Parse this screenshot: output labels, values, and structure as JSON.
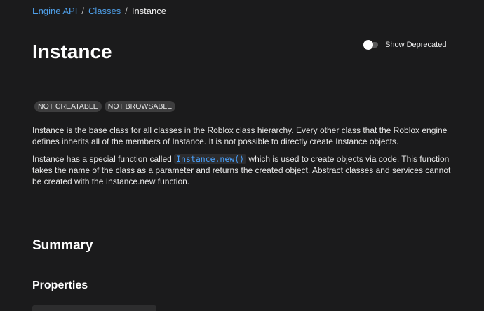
{
  "breadcrumb": {
    "items": [
      "Engine API",
      "Classes"
    ],
    "current": "Instance",
    "separator": "/"
  },
  "page": {
    "title": "Instance"
  },
  "toggle": {
    "label": "Show Deprecated",
    "checked": false
  },
  "tags": [
    "NOT CREATABLE",
    "NOT BROWSABLE"
  ],
  "description": {
    "p1": "Instance is the base class for all classes in the Roblox class hierarchy. Every other class that the Roblox engine defines inherits all of the members of Instance. It is not possible to directly create Instance objects.",
    "p2_before": "Instance has a special function called ",
    "p2_code": "Instance.new()",
    "p2_after": " which is used to create objects via code. This function takes the name of the class as a parameter and returns the created object. Abstract classes and services cannot be created with the Instance.new function."
  },
  "sections": {
    "summary": "Summary",
    "properties": "Properties"
  },
  "colors": {
    "background": "#1b1b1c",
    "link": "#4f9fe8",
    "code": "#4aa3ff",
    "tag_bg": "#3d3d3e"
  }
}
